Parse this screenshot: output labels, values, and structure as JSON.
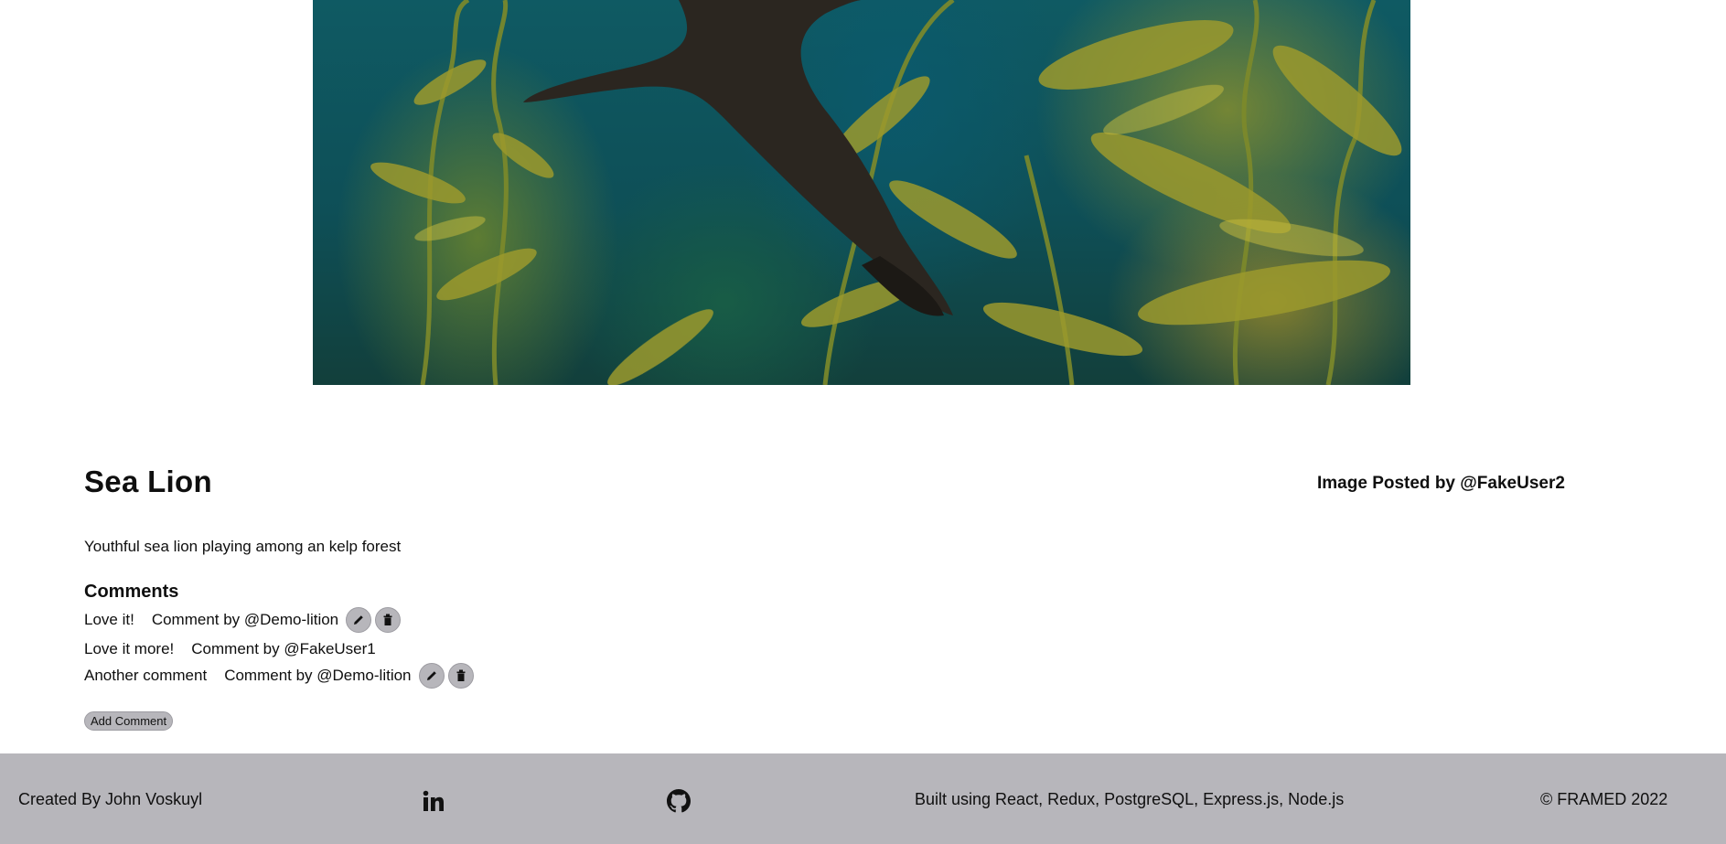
{
  "post": {
    "title": "Sea Lion",
    "posted_by": "Image Posted by @FakeUser2",
    "description": "Youthful sea lion playing among an kelp forest"
  },
  "comments": {
    "heading": "Comments",
    "items": [
      {
        "text": "Love it!",
        "author": "Comment by @Demo-lition",
        "editable": true
      },
      {
        "text": "Love it more!",
        "author": "Comment by @FakeUser1",
        "editable": false
      },
      {
        "text": "Another comment",
        "author": "Comment by @Demo-lition",
        "editable": true
      }
    ],
    "add_label": "Add Comment",
    "icons": {
      "edit": "pencil-icon",
      "delete": "trash-icon"
    }
  },
  "footer": {
    "created_by": "Created By John Voskuyl",
    "linkedin_icon": "linkedin-icon",
    "github_icon": "github-icon",
    "built_with": "Built using React, Redux, PostgreSQL, Express.js, Node.js",
    "copyright": "© FRAMED 2022"
  },
  "colors": {
    "footer_bg": "#b7b6bb",
    "button_bg": "#b7b6bb",
    "text": "#0f0f0f"
  }
}
